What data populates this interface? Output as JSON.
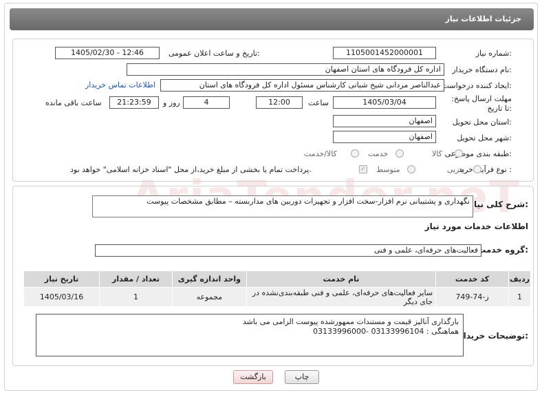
{
  "header": {
    "title": "جزئیات اطلاعات نیاز"
  },
  "need_number": {
    "label": "شماره نیاز:",
    "value": "1105001452000001"
  },
  "announce": {
    "label": "تاریخ و ساعت اعلان عمومی:",
    "value": "1405/02/30 - 12:46"
  },
  "buyer_org": {
    "label": "نام دستگاه خریدار:",
    "value": "اداره کل فرودگاه های استان اصفهان"
  },
  "creator": {
    "label": "ایجاد کننده درخواست:",
    "value": "عبدالناصر مردانی شیخ شبانی کارشناس مسئول  اداره کل فرودگاه های استان",
    "contact_link": "اطلاعات تماس خریدار"
  },
  "deadline": {
    "label": "مهلت ارسال پاسخ: تا تاریخ:",
    "date": "1405/03/04",
    "time_label": "ساعت",
    "time": "12:00",
    "days": "4",
    "days_label": "روز و",
    "remaining": "21:23:59",
    "remaining_label": "ساعت باقی مانده"
  },
  "province": {
    "label": "استان محل تحویل:",
    "value": "اصفهان"
  },
  "city": {
    "label": "شهر محل تحویل:",
    "value": "اصفهان"
  },
  "category": {
    "label": "طبقه بندی موضوعی:",
    "options": [
      "کالا",
      "خدمت",
      "کالا/خدمت"
    ]
  },
  "purchase_type": {
    "label": "نوع فرآیند خرید :",
    "options": [
      "جزیی",
      "متوسط"
    ],
    "note": "پرداخت تمام یا بخشی از مبلغ خرید،از محل \"اسناد خزانه اسلامی\" خواهد بود."
  },
  "description": {
    "label": "شرح کلی نیاز:",
    "value": "نگهداری و پشتیبانی  نرم افزار-سخت افزار و تجهیزات دوربین های مداربسته – مطابق مشخصات پیوست"
  },
  "services_title": "اطلاعات خدمات مورد نیاز",
  "service_group": {
    "label": "گروه خدمت:",
    "value": "فعالیت‌های حرفه‌ای، علمی و فنی"
  },
  "table": {
    "headers": [
      "ردیف",
      "کد خدمت",
      "نام خدمت",
      "واحد اندازه گیری",
      "تعداد / مقدار",
      "تاریخ نیاز"
    ],
    "rows": [
      [
        "1",
        "ز-74-749",
        "سایر فعالیت‌های حرفه‌ای، علمی و فنی طبقه‌بندی‌نشده در جای دیگر",
        "مجموعه",
        "1",
        "1405/03/16"
      ]
    ]
  },
  "buyer_notes": {
    "label": "توضیحات خریدار:",
    "line1": "بارگذاری آنالیز قیمت و مستندات ممهورشده پیوست الزامی می باشد",
    "line2": "هماهنگی : 03133996104 -03133996000"
  },
  "buttons": {
    "print": "چاپ",
    "back": "بازگشت"
  },
  "watermark": "AriaTender.neT",
  "colors": {
    "header_bg": "#7a7a7a",
    "link": "#1a55b5",
    "back_btn": "#f3d6d6"
  }
}
